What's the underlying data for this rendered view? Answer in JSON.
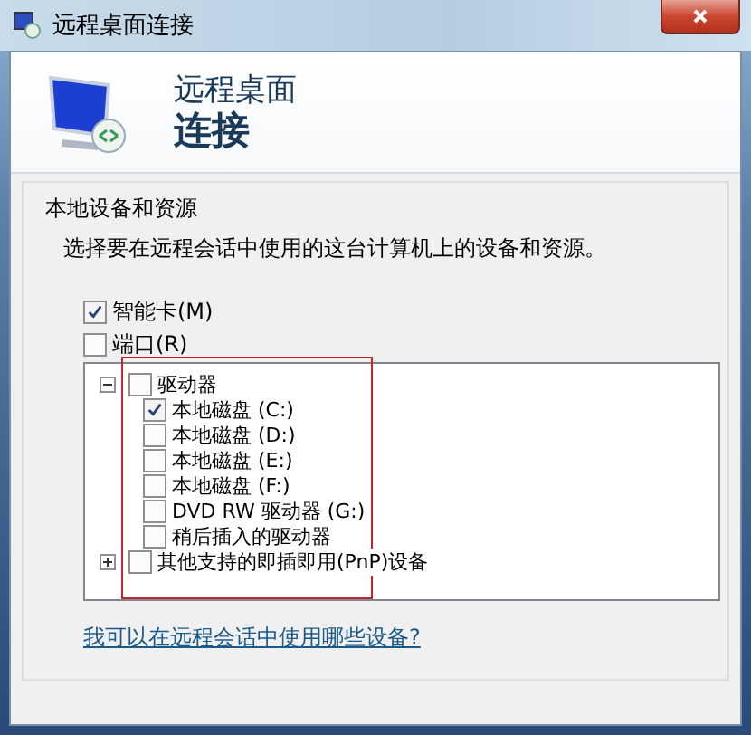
{
  "window": {
    "title": "远程桌面连接"
  },
  "header": {
    "line1": "远程桌面",
    "line2": "连接"
  },
  "group": {
    "title": "本地设备和资源",
    "description": "选择要在远程会话中使用的这台计算机上的设备和资源。",
    "options": [
      {
        "label": "智能卡(M)",
        "checked": true
      },
      {
        "label": "端口(R)",
        "checked": false
      }
    ],
    "tree": [
      {
        "label": "驱动器",
        "checked": false,
        "expanded": true,
        "children": [
          {
            "label": "本地磁盘 (C:)",
            "checked": true
          },
          {
            "label": "本地磁盘 (D:)",
            "checked": false
          },
          {
            "label": "本地磁盘 (E:)",
            "checked": false
          },
          {
            "label": "本地磁盘 (F:)",
            "checked": false
          },
          {
            "label": "DVD RW 驱动器 (G:)",
            "checked": false
          },
          {
            "label": "稍后插入的驱动器",
            "checked": false
          }
        ]
      },
      {
        "label": "其他支持的即插即用(PnP)设备",
        "checked": false,
        "expanded": false
      }
    ]
  },
  "help_link": "我可以在远程会话中使用哪些设备?"
}
